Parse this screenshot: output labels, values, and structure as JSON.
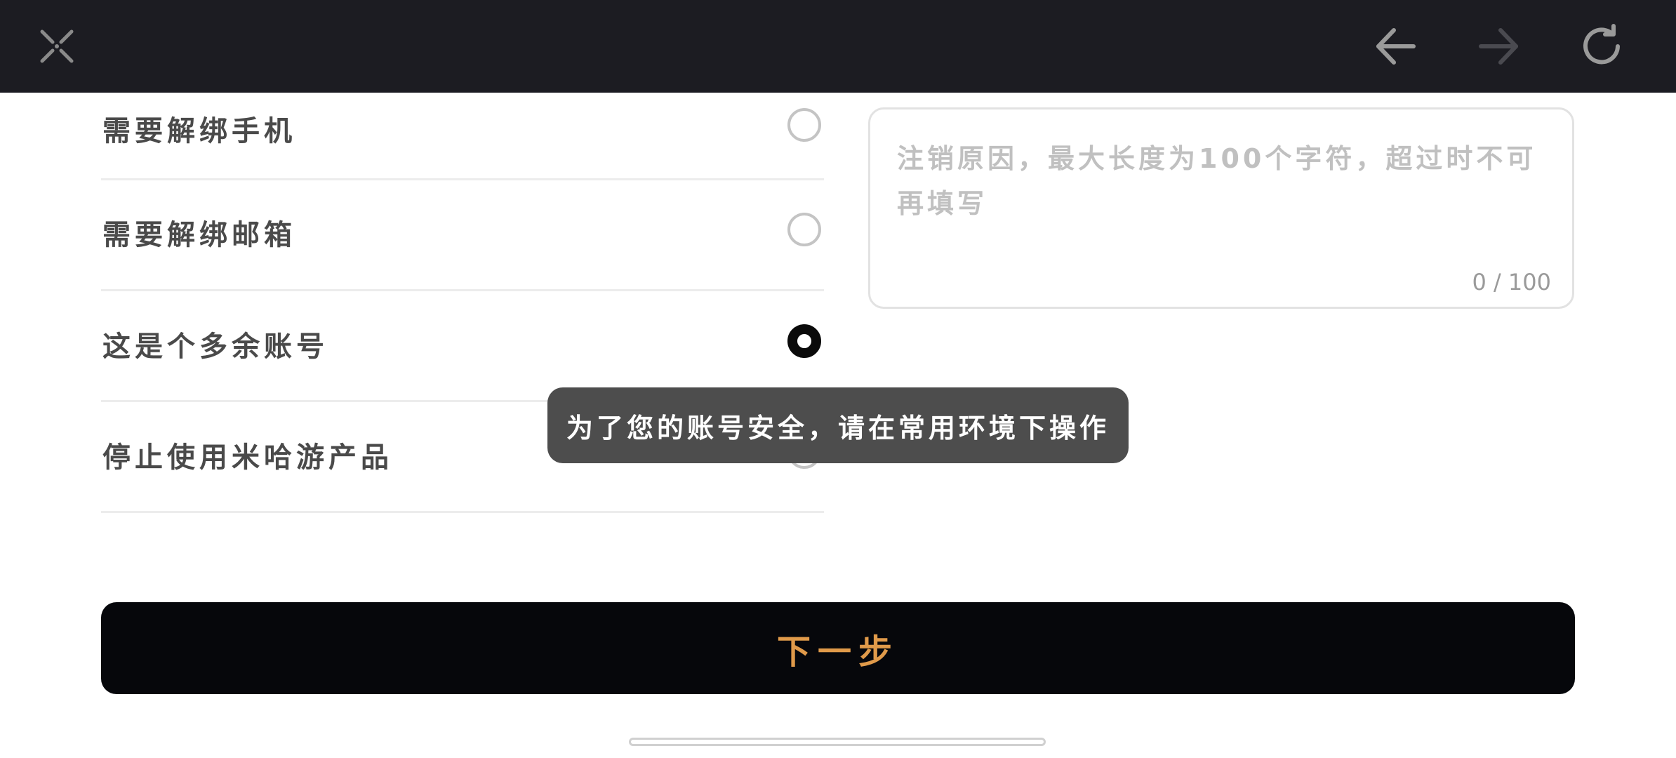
{
  "toolbar": {
    "close_icon": "close-icon",
    "back_icon": "arrow-left-icon",
    "forward_icon": "arrow-right-icon",
    "refresh_icon": "refresh-icon"
  },
  "options": [
    {
      "label": "需要解绑手机",
      "selected": false
    },
    {
      "label": "需要解绑邮箱",
      "selected": false
    },
    {
      "label": "这是个多余账号",
      "selected": true
    },
    {
      "label": "停止使用米哈游产品",
      "selected": false
    }
  ],
  "reason": {
    "placeholder": "注销原因，最大长度为100个字符，超过时不可再填写",
    "value": "",
    "counter": "0 / 100"
  },
  "toast": {
    "text": "为了您的账号安全，请在常用环境下操作"
  },
  "next_button": {
    "label": "下一步"
  },
  "colors": {
    "topbar_bg": "#1c1c22",
    "button_bg": "#06070b",
    "button_text": "#e09a4a",
    "toast_bg": "#4d4d4d"
  }
}
